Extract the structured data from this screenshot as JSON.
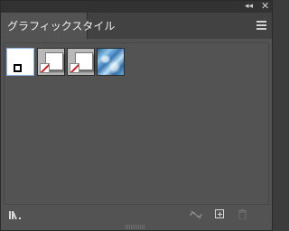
{
  "panel": {
    "tab_title": "グラフィックスタイル",
    "titlebar": {
      "collapse_glyph": "◂◂",
      "close_glyph": "✕"
    }
  },
  "swatches": [
    {
      "id": "default",
      "icon": "default-graphic-style"
    },
    {
      "id": "style-2",
      "icon": "white-box-shadow"
    },
    {
      "id": "style-3",
      "icon": "white-box-shadow"
    },
    {
      "id": "style-4",
      "icon": "blue-texture"
    }
  ],
  "footer": {
    "icons": [
      "libraries-icon",
      "break-link-icon",
      "new-style-icon",
      "delete-icon"
    ]
  },
  "colors": {
    "panel_bg": "#535353",
    "titlebar_bg": "#323232",
    "selection": "#8fb4e6",
    "no_stroke_red": "#d21e1e"
  }
}
